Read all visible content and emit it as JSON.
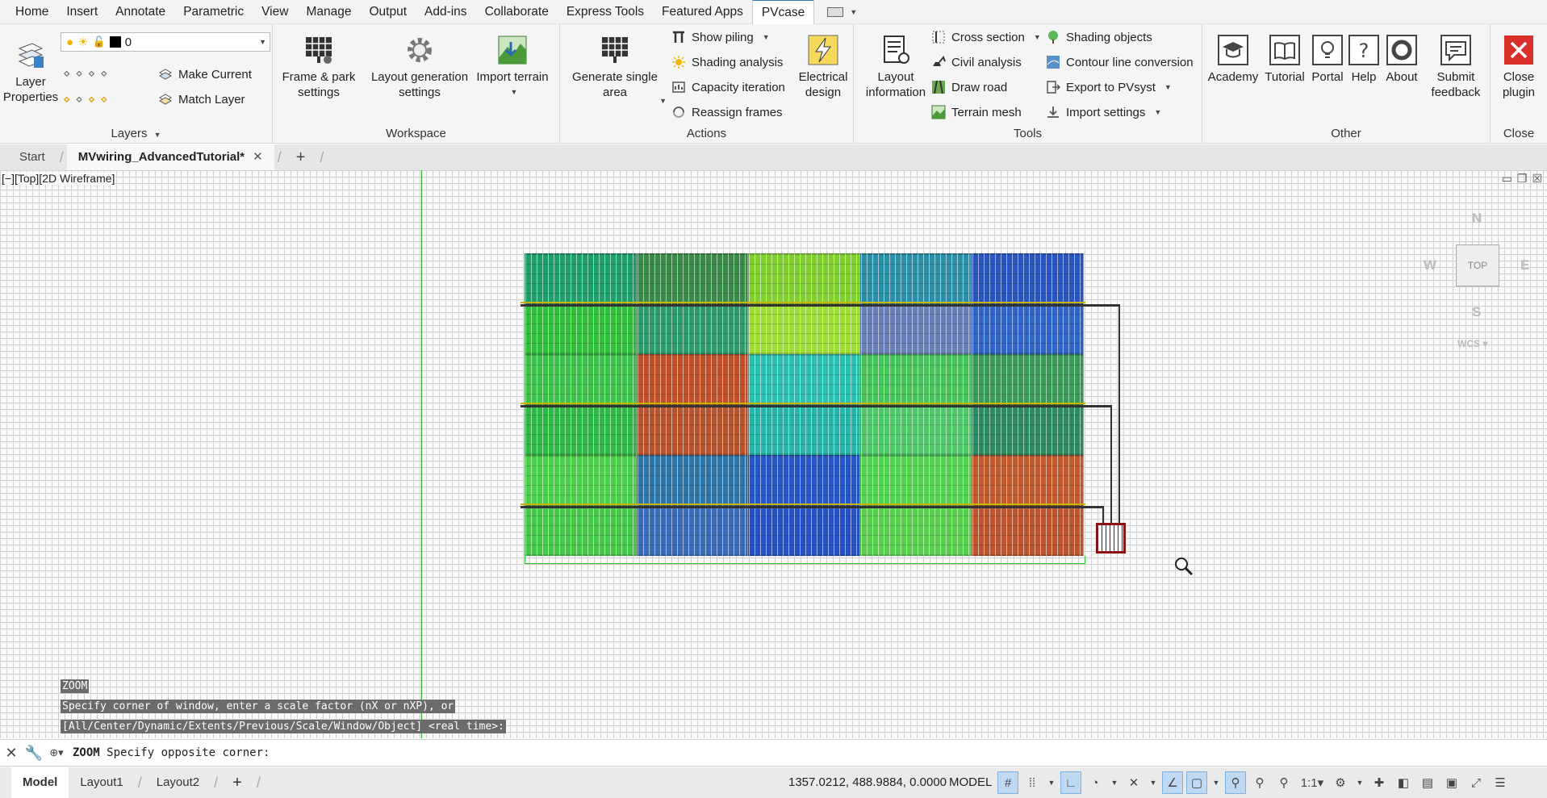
{
  "menu": {
    "items": [
      "Home",
      "Insert",
      "Annotate",
      "Parametric",
      "View",
      "Manage",
      "Output",
      "Add-ins",
      "Collaborate",
      "Express Tools",
      "Featured Apps",
      "PVcase"
    ],
    "active": "PVcase"
  },
  "ribbon": {
    "layers": {
      "title": "Layers",
      "layer_properties": "Layer\nProperties",
      "current_layer": "0",
      "make_current": "Make Current",
      "match_layer": "Match Layer"
    },
    "workspace": {
      "title": "Workspace",
      "frame_park": "Frame & park\nsettings",
      "layout_generation": "Layout generation\nsettings",
      "import_terrain": "Import terrain"
    },
    "actions": {
      "title": "Actions",
      "generate_single": "Generate single\narea",
      "show_piling": "Show piling",
      "shading_analysis": "Shading analysis",
      "capacity_iteration": "Capacity iteration",
      "reassign_frames": "Reassign frames",
      "electrical_design": "Electrical\ndesign"
    },
    "tools": {
      "title": "Tools",
      "layout_information": "Layout\ninformation",
      "cross_section": "Cross section",
      "civil_analysis": "Civil analysis",
      "draw_road": "Draw road",
      "terrain_mesh": "Terrain mesh",
      "shading_objects": "Shading objects",
      "contour_line": "Contour line conversion",
      "export_pvsyst": "Export to PVsyst",
      "import_settings": "Import settings"
    },
    "other": {
      "title": "Other",
      "academy": "Academy",
      "tutorial": "Tutorial",
      "portal": "Portal",
      "help": "Help",
      "about": "About",
      "submit_feedback": "Submit\nfeedback"
    },
    "close": {
      "title": "Close",
      "close_plugin": "Close\nplugin"
    }
  },
  "doc_tabs": {
    "start": "Start",
    "active": "MVwiring_AdvancedTutorial*"
  },
  "viewport": {
    "label": "[−][Top][2D Wireframe]",
    "compass": {
      "n": "N",
      "w": "W",
      "e": "E",
      "s": "S"
    },
    "cube_face": "TOP",
    "wcs": "WCS"
  },
  "command_history": [
    "ZOOM",
    "Specify corner of window, enter a scale factor (nX or nXP), or",
    "[All/Center/Dynamic/Extents/Previous/Scale/Window/Object] <real time>:"
  ],
  "command_line": {
    "command": "ZOOM",
    "prompt": "Specify opposite corner:"
  },
  "status": {
    "layout_tabs": [
      "Model",
      "Layout1",
      "Layout2"
    ],
    "active_tab": "Model",
    "coordinates": "1357.0212, 488.9884, 0.0000",
    "space": "MODEL",
    "scale": "1:1"
  },
  "colors": {
    "accent": "#2a7ab9",
    "array_green": "#2fbf3a",
    "array_blue": "#2450c8",
    "array_teal": "#23b8a8",
    "array_red": "#b04a2a",
    "substation": "#8b1111"
  },
  "array_cells": [
    "#1e9e6a",
    "#3a8a4a",
    "#7fcf2e",
    "#2b8fa8",
    "#2a55c0",
    "#2fbf3a",
    "#2c9a6a",
    "#9fdc35",
    "#6a7fb8",
    "#2f64c8",
    "#3cc24a",
    "#c0502a",
    "#2bbfb0",
    "#48c55a",
    "#3a9a5a",
    "#2fb845",
    "#b8542d",
    "#28b4a8",
    "#4fc86a",
    "#2e8a60",
    "#4ccf4a",
    "#2f76a8",
    "#2456c8",
    "#52d450",
    "#c25a2e",
    "#46c84a",
    "#3a6ab8",
    "#2551c4",
    "#58d04e",
    "#bd5630"
  ]
}
